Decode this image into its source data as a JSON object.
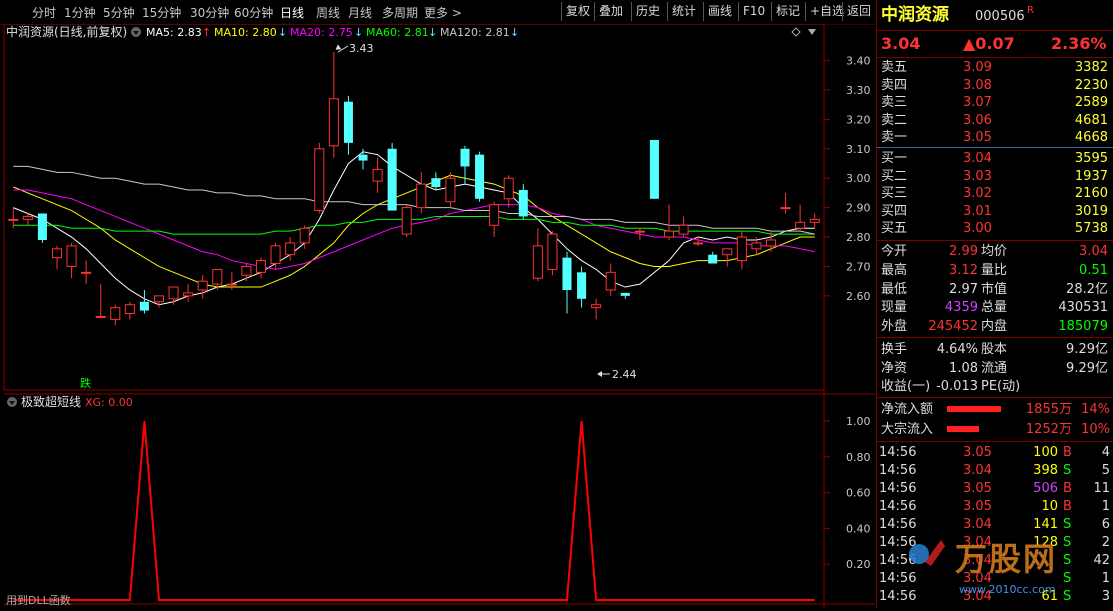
{
  "toolbar": {
    "periods": [
      "分时",
      "1分钟",
      "5分钟",
      "15分钟",
      "30分钟",
      "60分钟",
      "日线",
      "周线",
      "月线",
      "多周期",
      "更多 >"
    ],
    "active_period": "日线",
    "buttons": [
      "复权",
      "叠加",
      "历史",
      "统计",
      "画线",
      "F10",
      "标记",
      "+自选",
      "返回"
    ]
  },
  "legend": {
    "title": "中润资源(日线,前复权)",
    "items": [
      {
        "label": "MA5: 2.83",
        "arrow": "↑",
        "color": "#ffffff"
      },
      {
        "label": "MA10: 2.80",
        "arrow": "↓",
        "color": "#ffff00"
      },
      {
        "label": "MA20: 2.75",
        "arrow": "↓",
        "color": "#ff00ff"
      },
      {
        "label": "MA60: 2.81",
        "arrow": "↓",
        "color": "#00ff00"
      },
      {
        "label": "MA120: 2.81",
        "arrow": "↓",
        "color": "#c8c8c8"
      }
    ]
  },
  "annotations": {
    "high": "3.43",
    "low": "2.44",
    "tag": "跌"
  },
  "indicator": {
    "title": "极致超短线",
    "xg": "XG: 0.00",
    "footer": "用到DLL函数"
  },
  "chart_data": [
    {
      "type": "candlestick",
      "title": "中润资源(日线,前复权)",
      "ylim": [
        2.5,
        3.45
      ],
      "yticks": [
        "3.40",
        "3.30",
        "3.20",
        "3.10",
        "3.00",
        "2.90",
        "2.80",
        "2.70",
        "2.60"
      ],
      "candles": [
        {
          "o": 2.86,
          "h": 2.9,
          "l": 2.83,
          "c": 2.86
        },
        {
          "o": 2.86,
          "h": 2.88,
          "l": 2.84,
          "c": 2.87
        },
        {
          "o": 2.88,
          "h": 2.88,
          "l": 2.78,
          "c": 2.79
        },
        {
          "o": 2.73,
          "h": 2.77,
          "l": 2.69,
          "c": 2.76
        },
        {
          "o": 2.7,
          "h": 2.78,
          "l": 2.66,
          "c": 2.77
        },
        {
          "o": 2.68,
          "h": 2.72,
          "l": 2.64,
          "c": 2.68
        },
        {
          "o": 2.53,
          "h": 2.64,
          "l": 2.53,
          "c": 2.53
        },
        {
          "o": 2.52,
          "h": 2.57,
          "l": 2.5,
          "c": 2.56
        },
        {
          "o": 2.54,
          "h": 2.58,
          "l": 2.52,
          "c": 2.57
        },
        {
          "o": 2.58,
          "h": 2.62,
          "l": 2.54,
          "c": 2.55
        },
        {
          "o": 2.58,
          "h": 2.6,
          "l": 2.56,
          "c": 2.6
        },
        {
          "o": 2.59,
          "h": 2.63,
          "l": 2.57,
          "c": 2.63
        },
        {
          "o": 2.6,
          "h": 2.64,
          "l": 2.58,
          "c": 2.61
        },
        {
          "o": 2.62,
          "h": 2.67,
          "l": 2.59,
          "c": 2.65
        },
        {
          "o": 2.64,
          "h": 2.69,
          "l": 2.62,
          "c": 2.69
        },
        {
          "o": 2.64,
          "h": 2.68,
          "l": 2.62,
          "c": 2.64
        },
        {
          "o": 2.67,
          "h": 2.71,
          "l": 2.65,
          "c": 2.7
        },
        {
          "o": 2.68,
          "h": 2.73,
          "l": 2.66,
          "c": 2.72
        },
        {
          "o": 2.71,
          "h": 2.78,
          "l": 2.69,
          "c": 2.77
        },
        {
          "o": 2.74,
          "h": 2.8,
          "l": 2.72,
          "c": 2.78
        },
        {
          "o": 2.78,
          "h": 2.84,
          "l": 2.76,
          "c": 2.83
        },
        {
          "o": 2.89,
          "h": 3.12,
          "l": 2.88,
          "c": 3.1
        },
        {
          "o": 3.11,
          "h": 3.43,
          "l": 3.07,
          "c": 3.27
        },
        {
          "o": 3.26,
          "h": 3.28,
          "l": 3.08,
          "c": 3.12
        },
        {
          "o": 3.08,
          "h": 3.1,
          "l": 3.03,
          "c": 3.06
        },
        {
          "o": 2.99,
          "h": 3.07,
          "l": 2.95,
          "c": 3.03
        },
        {
          "o": 3.1,
          "h": 3.12,
          "l": 2.9,
          "c": 2.89
        },
        {
          "o": 2.81,
          "h": 2.91,
          "l": 2.8,
          "c": 2.9
        },
        {
          "o": 2.9,
          "h": 3.02,
          "l": 2.88,
          "c": 2.98
        },
        {
          "o": 3.0,
          "h": 3.02,
          "l": 2.96,
          "c": 2.97
        },
        {
          "o": 2.92,
          "h": 3.02,
          "l": 2.9,
          "c": 3.0
        },
        {
          "o": 3.1,
          "h": 3.11,
          "l": 2.98,
          "c": 3.04
        },
        {
          "o": 3.08,
          "h": 3.09,
          "l": 2.92,
          "c": 2.93
        },
        {
          "o": 2.84,
          "h": 2.92,
          "l": 2.8,
          "c": 2.91
        },
        {
          "o": 2.93,
          "h": 3.01,
          "l": 2.9,
          "c": 3.0
        },
        {
          "o": 2.96,
          "h": 2.98,
          "l": 2.86,
          "c": 2.87
        },
        {
          "o": 2.66,
          "h": 2.83,
          "l": 2.65,
          "c": 2.77
        },
        {
          "o": 2.69,
          "h": 2.82,
          "l": 2.67,
          "c": 2.81
        },
        {
          "o": 2.73,
          "h": 2.75,
          "l": 2.54,
          "c": 2.62
        },
        {
          "o": 2.68,
          "h": 2.7,
          "l": 2.56,
          "c": 2.59
        },
        {
          "o": 2.56,
          "h": 2.59,
          "l": 2.52,
          "c": 2.57
        },
        {
          "o": 2.62,
          "h": 2.71,
          "l": 2.6,
          "c": 2.68
        },
        {
          "o": 2.61,
          "h": 2.61,
          "l": 2.59,
          "c": 2.6
        },
        {
          "o": 2.82,
          "h": 2.83,
          "l": 2.79,
          "c": 2.82
        },
        {
          "o": 3.13,
          "h": 3.13,
          "l": 2.93,
          "c": 2.93
        },
        {
          "o": 2.8,
          "h": 2.91,
          "l": 2.79,
          "c": 2.82
        },
        {
          "o": 2.81,
          "h": 2.87,
          "l": 2.8,
          "c": 2.84
        },
        {
          "o": 2.78,
          "h": 2.8,
          "l": 2.77,
          "c": 2.78
        },
        {
          "o": 2.74,
          "h": 2.75,
          "l": 2.71,
          "c": 2.71
        },
        {
          "o": 2.74,
          "h": 2.76,
          "l": 2.7,
          "c": 2.76
        },
        {
          "o": 2.72,
          "h": 2.82,
          "l": 2.69,
          "c": 2.8
        },
        {
          "o": 2.76,
          "h": 2.8,
          "l": 2.74,
          "c": 2.78
        },
        {
          "o": 2.77,
          "h": 2.82,
          "l": 2.75,
          "c": 2.79
        },
        {
          "o": 2.9,
          "h": 2.95,
          "l": 2.88,
          "c": 2.9
        },
        {
          "o": 2.83,
          "h": 2.91,
          "l": 2.82,
          "c": 2.85
        },
        {
          "o": 2.85,
          "h": 2.88,
          "l": 2.83,
          "c": 2.86
        }
      ],
      "series": [
        {
          "name": "MA5",
          "color": "#ffffff",
          "values": [
            2.9,
            2.88,
            2.86,
            2.83,
            2.8,
            2.76,
            2.71,
            2.66,
            2.62,
            2.59,
            2.57,
            2.58,
            2.6,
            2.61,
            2.63,
            2.64,
            2.66,
            2.68,
            2.71,
            2.74,
            2.78,
            2.86,
            2.96,
            3.05,
            3.09,
            3.08,
            3.04,
            3.01,
            2.98,
            2.96,
            2.97,
            2.98,
            2.97,
            2.96,
            2.95,
            2.9,
            2.86,
            2.81,
            2.76,
            2.72,
            2.69,
            2.65,
            2.63,
            2.64,
            2.68,
            2.72,
            2.78,
            2.8,
            2.79,
            2.8,
            2.79,
            2.79,
            2.8,
            2.82,
            2.83,
            2.83
          ]
        },
        {
          "name": "MA10",
          "color": "#ffff00",
          "values": [
            2.97,
            2.95,
            2.93,
            2.91,
            2.89,
            2.86,
            2.83,
            2.79,
            2.76,
            2.73,
            2.7,
            2.68,
            2.66,
            2.64,
            2.63,
            2.63,
            2.63,
            2.63,
            2.65,
            2.67,
            2.7,
            2.74,
            2.78,
            2.84,
            2.88,
            2.91,
            2.93,
            2.95,
            2.97,
            2.99,
            3.01,
            3.0,
            2.99,
            2.98,
            2.96,
            2.94,
            2.9,
            2.87,
            2.84,
            2.81,
            2.78,
            2.75,
            2.73,
            2.71,
            2.7,
            2.7,
            2.71,
            2.72,
            2.72,
            2.72,
            2.73,
            2.74,
            2.76,
            2.78,
            2.8,
            2.8
          ]
        },
        {
          "name": "MA20",
          "color": "#ff00ff",
          "values": [
            2.96,
            2.96,
            2.95,
            2.94,
            2.93,
            2.91,
            2.89,
            2.87,
            2.85,
            2.83,
            2.81,
            2.79,
            2.77,
            2.75,
            2.74,
            2.72,
            2.71,
            2.7,
            2.69,
            2.7,
            2.71,
            2.73,
            2.75,
            2.77,
            2.79,
            2.81,
            2.83,
            2.84,
            2.85,
            2.86,
            2.88,
            2.89,
            2.9,
            2.91,
            2.91,
            2.91,
            2.9,
            2.88,
            2.87,
            2.86,
            2.84,
            2.83,
            2.82,
            2.81,
            2.8,
            2.8,
            2.8,
            2.79,
            2.78,
            2.78,
            2.78,
            2.77,
            2.77,
            2.77,
            2.76,
            2.75
          ]
        },
        {
          "name": "MA60",
          "color": "#00ff00",
          "values": [
            2.84,
            2.84,
            2.84,
            2.84,
            2.83,
            2.83,
            2.83,
            2.82,
            2.82,
            2.82,
            2.82,
            2.81,
            2.81,
            2.81,
            2.81,
            2.81,
            2.81,
            2.81,
            2.82,
            2.82,
            2.83,
            2.84,
            2.84,
            2.85,
            2.85,
            2.86,
            2.86,
            2.86,
            2.86,
            2.87,
            2.87,
            2.87,
            2.87,
            2.87,
            2.86,
            2.86,
            2.86,
            2.85,
            2.85,
            2.84,
            2.84,
            2.84,
            2.83,
            2.83,
            2.83,
            2.82,
            2.82,
            2.82,
            2.82,
            2.82,
            2.82,
            2.82,
            2.81,
            2.81,
            2.81,
            2.81
          ]
        },
        {
          "name": "MA120",
          "color": "#c8c8c8",
          "values": [
            3.04,
            3.04,
            3.03,
            3.02,
            3.02,
            3.01,
            3.0,
            3.0,
            2.99,
            2.98,
            2.98,
            2.97,
            2.96,
            2.96,
            2.95,
            2.95,
            2.94,
            2.94,
            2.93,
            2.93,
            2.93,
            2.92,
            2.92,
            2.92,
            2.91,
            2.91,
            2.91,
            2.91,
            2.9,
            2.9,
            2.9,
            2.89,
            2.89,
            2.89,
            2.88,
            2.88,
            2.87,
            2.87,
            2.87,
            2.86,
            2.86,
            2.86,
            2.85,
            2.85,
            2.85,
            2.84,
            2.84,
            2.84,
            2.83,
            2.83,
            2.83,
            2.83,
            2.82,
            2.82,
            2.82,
            2.81
          ]
        }
      ]
    },
    {
      "type": "line",
      "title": "极致超短线",
      "ylim": [
        0,
        1.05
      ],
      "yticks": [
        "1.00",
        "0.80",
        "0.60",
        "0.40",
        "0.20"
      ],
      "series": [
        {
          "name": "XG",
          "color": "#ff0000",
          "values": [
            0,
            0,
            0,
            0,
            0,
            0,
            0,
            0,
            0,
            1,
            0,
            0,
            0,
            0,
            0,
            0,
            0,
            0,
            0,
            0,
            0,
            0,
            0,
            0,
            0,
            0,
            0,
            0,
            0,
            0,
            0,
            0,
            0,
            0,
            0,
            0,
            0,
            0,
            0,
            1,
            0,
            0,
            0,
            0,
            0,
            0,
            0,
            0,
            0,
            0,
            0,
            0,
            0,
            0,
            0,
            0
          ]
        }
      ]
    }
  ],
  "panel": {
    "name": "中润资源",
    "code": "000506",
    "badge": "R",
    "price": "3.04",
    "change": "▲0.07",
    "pct": "2.36%",
    "asks": [
      {
        "label": "卖五",
        "price": "3.09",
        "vol": "3382"
      },
      {
        "label": "卖四",
        "price": "3.08",
        "vol": "2230"
      },
      {
        "label": "卖三",
        "price": "3.07",
        "vol": "2589"
      },
      {
        "label": "卖二",
        "price": "3.06",
        "vol": "4681"
      },
      {
        "label": "卖一",
        "price": "3.05",
        "vol": "4668"
      }
    ],
    "bids": [
      {
        "label": "买一",
        "price": "3.04",
        "vol": "3595"
      },
      {
        "label": "买二",
        "price": "3.03",
        "vol": "1937"
      },
      {
        "label": "买三",
        "price": "3.02",
        "vol": "2160"
      },
      {
        "label": "买四",
        "price": "3.01",
        "vol": "3019"
      },
      {
        "label": "买五",
        "price": "3.00",
        "vol": "5738"
      }
    ],
    "stats": [
      {
        "l1": "今开",
        "v1": "2.99",
        "c1": "#ff3333",
        "l2": "均价",
        "v2": "3.04",
        "c2": "#ff3333"
      },
      {
        "l1": "最高",
        "v1": "3.12",
        "c1": "#ff3333",
        "l2": "量比",
        "v2": "0.51",
        "c2": "#00ff00"
      },
      {
        "l1": "最低",
        "v1": "2.97",
        "c1": "#dddddd",
        "l2": "市值",
        "v2": "28.2亿",
        "c2": "#dddddd"
      },
      {
        "l1": "现量",
        "v1": "4359",
        "c1": "#cc44ff",
        "l2": "总量",
        "v2": "430531",
        "c2": "#dddddd"
      },
      {
        "l1": "外盘",
        "v1": "245452",
        "c1": "#ff3333",
        "l2": "内盘",
        "v2": "185079",
        "c2": "#00ff00"
      }
    ],
    "stats2": [
      {
        "l1": "换手",
        "v1": "4.64%",
        "l2": "股本",
        "v2": "9.29亿"
      },
      {
        "l1": "净资",
        "v1": "1.08",
        "l2": "流通",
        "v2": "9.29亿"
      },
      {
        "l1": "收益(一)",
        "v1": "-0.013",
        "l2": "PE(动)",
        "v2": ""
      }
    ],
    "flows": [
      {
        "label": "净流入额",
        "value": "1855万",
        "pct": "14%",
        "fill": 1.0
      },
      {
        "label": "大宗流入",
        "value": "1252万",
        "pct": "10%",
        "fill": 0.6
      }
    ],
    "ticks": [
      {
        "time": "14:56",
        "price": "3.05",
        "vol": "100",
        "bs": "B",
        "n": "4",
        "volc": "#ffff00"
      },
      {
        "time": "14:56",
        "price": "3.04",
        "vol": "398",
        "bs": "S",
        "n": "5",
        "volc": "#ffff00"
      },
      {
        "time": "14:56",
        "price": "3.05",
        "vol": "506",
        "bs": "B",
        "n": "11",
        "volc": "#cc44ff"
      },
      {
        "time": "14:56",
        "price": "3.05",
        "vol": "10",
        "bs": "B",
        "n": "1",
        "volc": "#ffff00"
      },
      {
        "time": "14:56",
        "price": "3.04",
        "vol": "141",
        "bs": "S",
        "n": "6",
        "volc": "#ffff00"
      },
      {
        "time": "14:56",
        "price": "3.04",
        "vol": "128",
        "bs": "S",
        "n": "2",
        "volc": "#ffff00"
      },
      {
        "time": "14:56",
        "price": "3.04",
        "vol": "",
        "bs": "S",
        "n": "42",
        "volc": "#ffff00"
      },
      {
        "time": "14:56",
        "price": "3.04",
        "vol": "",
        "bs": "S",
        "n": "1",
        "volc": "#ffff00"
      },
      {
        "time": "14:56",
        "price": "3.04",
        "vol": "61",
        "bs": "S",
        "n": "3",
        "volc": "#ffff00"
      }
    ]
  },
  "watermark": {
    "brand": "万股网",
    "url": "www.2010cc.com"
  }
}
